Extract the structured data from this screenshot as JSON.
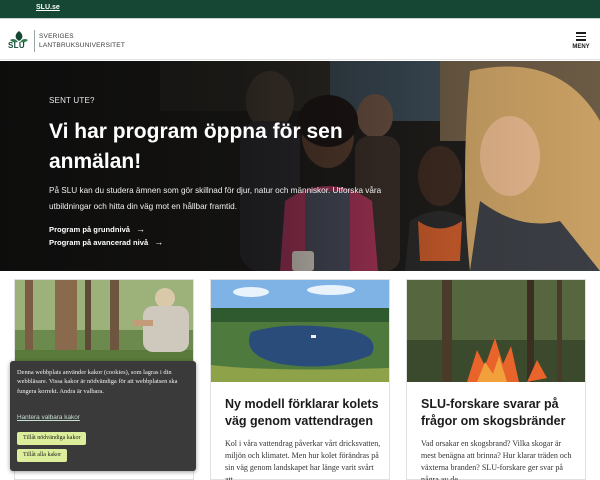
{
  "topbar": {
    "link": "SLU.se",
    "color": "#154734"
  },
  "header": {
    "wordmark": "SLU",
    "university_line1": "SVERIGES",
    "university_line2": "LANTBRUKSUNIVERSITET",
    "menu_label": "MENY",
    "logo_icon": "slu-leaf-logo",
    "menu_icon": "hamburger-icon"
  },
  "hero": {
    "eyebrow": "SENT UTE?",
    "title": "Vi har program öppna för sen anmälan!",
    "body": "På SLU kan du studera ämnen som gör skillnad för djur, natur och människor. Utforska våra utbildningar och hitta din väg mot en hållbar framtid.",
    "links": [
      {
        "label": "Program på grundnivå",
        "icon": "arrow-right-icon"
      },
      {
        "label": "Program på avancerad nivå",
        "icon": "arrow-right-icon"
      }
    ]
  },
  "cards": [
    {
      "title": "",
      "body": "... ... ... ...",
      "image": "forest-researcher-photo"
    },
    {
      "title": "Ny modell förklarar kolets väg genom vattendragen",
      "body": "Kol i våra vattendrag påverkar vårt dricksvatten, miljön och klimatet. Men hur kolet förändras på sin väg genom landskapet har länge varit svårt att...",
      "image": "lake-landscape-photo"
    },
    {
      "title": "SLU-forskare svarar på frågor om skogsbränder",
      "body": "Vad orsakar en skogsbrand? Vilka skogar är mest benägna att brinna? Hur klarar träden och växterna branden? SLU-forskare ger svar på några av de...",
      "image": "forest-fire-photo"
    }
  ],
  "cookie": {
    "text": "Denna webbplats använder kakor (cookies), som lagras i din webbläsare. Vissa kakor är nödvändiga för att webbplatsen ska fungera korrekt. Andra är valbara.",
    "manage": "Hantera valbara kakor",
    "btn_necessary": "Tillåt nödvändiga kakor",
    "btn_all": "Tillåt alla kakor",
    "button_color": "#dcee9c"
  },
  "colors": {
    "brand_green": "#154734",
    "text_dark": "#1b1b1b"
  }
}
